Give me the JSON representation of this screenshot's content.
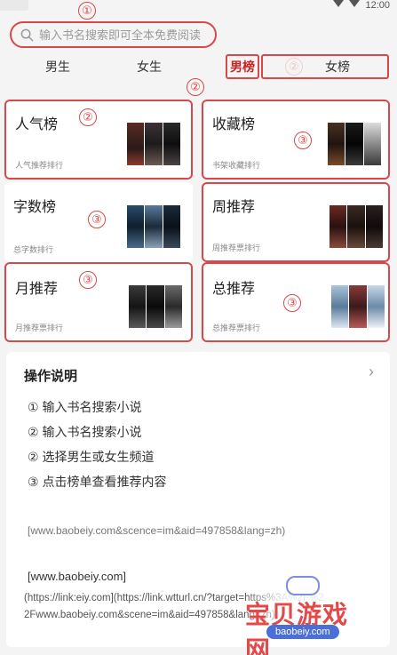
{
  "status": {
    "time": "12:00"
  },
  "annotations": {
    "n1": "①",
    "n2": "②",
    "n3": "③"
  },
  "search": {
    "placeholder": "输入书名搜索即可全本免费阅读"
  },
  "tabs": {
    "male": "男生",
    "female": "女生",
    "male_rank": "男榜",
    "female_rank": "女榜"
  },
  "cards": [
    {
      "title": "人气榜",
      "sub": "人气推荐排行"
    },
    {
      "title": "收藏榜",
      "sub": "书架收藏排行"
    },
    {
      "title": "字数榜",
      "sub": "总字数排行"
    },
    {
      "title": "周推荐",
      "sub": "周推荐票排行"
    },
    {
      "title": "月推荐",
      "sub": "月推荐票排行"
    },
    {
      "title": "总推荐",
      "sub": "总推荐票排行"
    }
  ],
  "panel": {
    "title": "操作说明",
    "steps": [
      "① 输入书名搜索小说",
      "② 输入书名搜索小说",
      "② 选择男生或女生频道",
      "③ 点击榜单查看推荐内容"
    ],
    "link1": "[www.baobeiy.com&scence=im&aid=497858&lang=zh)",
    "link2": "[www.baobeiy.com]",
    "link3a": "(https://link:eiy.com](https://link.wtturl.cn/?target=https%3A%2F%2",
    "link3b": "2Fwww.baobeiy.com&scene=im&aid=497858&lang=zh)"
  },
  "watermark": {
    "text": "宝贝游戏网",
    "url": "baobeiy.com"
  },
  "colors": {
    "accent": "#d94848"
  }
}
